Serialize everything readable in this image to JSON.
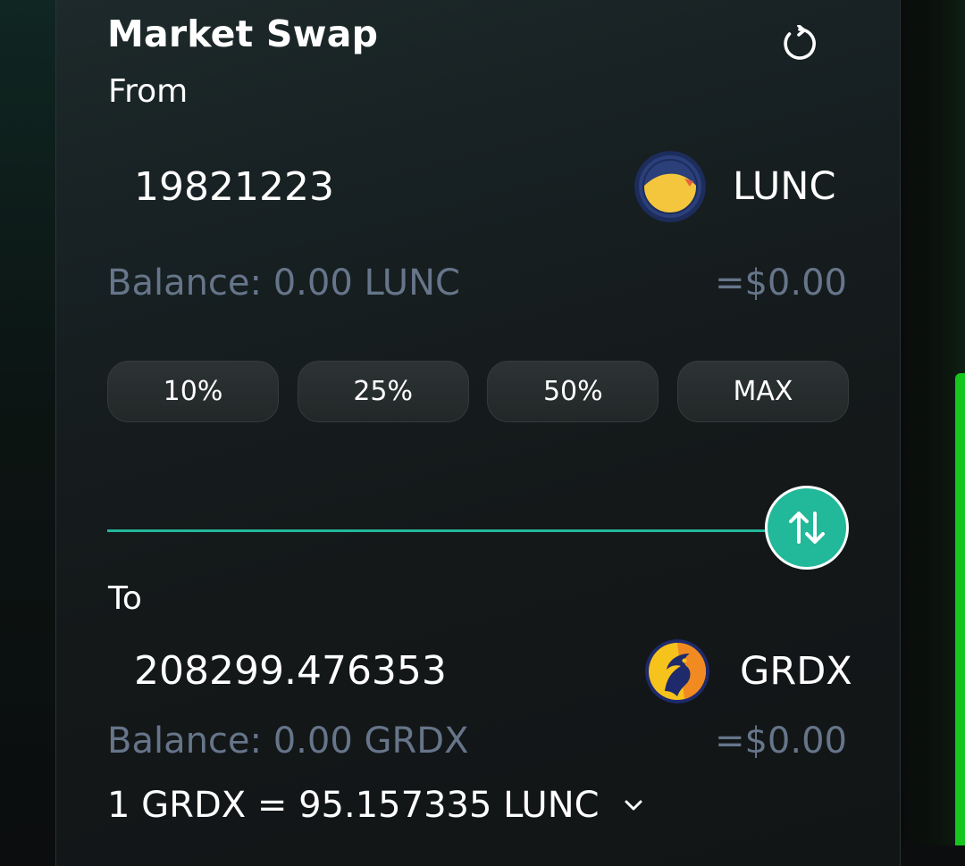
{
  "header": {
    "title": "Market Swap",
    "refresh_icon": "refresh-icon"
  },
  "from": {
    "label": "From",
    "amount": "19821223",
    "token_symbol": "LUNC",
    "token_icon": "lunc-logo",
    "balance": "Balance: 0.00 LUNC",
    "usd_value": "=$0.00",
    "percent_buttons": [
      "10%",
      "25%",
      "50%",
      "MAX"
    ]
  },
  "switch": {
    "icon": "swap-arrows-icon",
    "color": "#22b89a"
  },
  "to": {
    "label": "To",
    "amount": "208299.476353",
    "token_symbol": "GRDX",
    "token_icon": "grdx-logo",
    "balance": "Balance: 0.00 GRDX",
    "usd_value": "=$0.00"
  },
  "rate": {
    "text": "1 GRDX = 95.157335 LUNC",
    "icon": "chevron-down-icon"
  },
  "colors": {
    "accent": "#22b89a",
    "muted_text": "#66758a",
    "scroll_indicator": "#16c51e"
  }
}
